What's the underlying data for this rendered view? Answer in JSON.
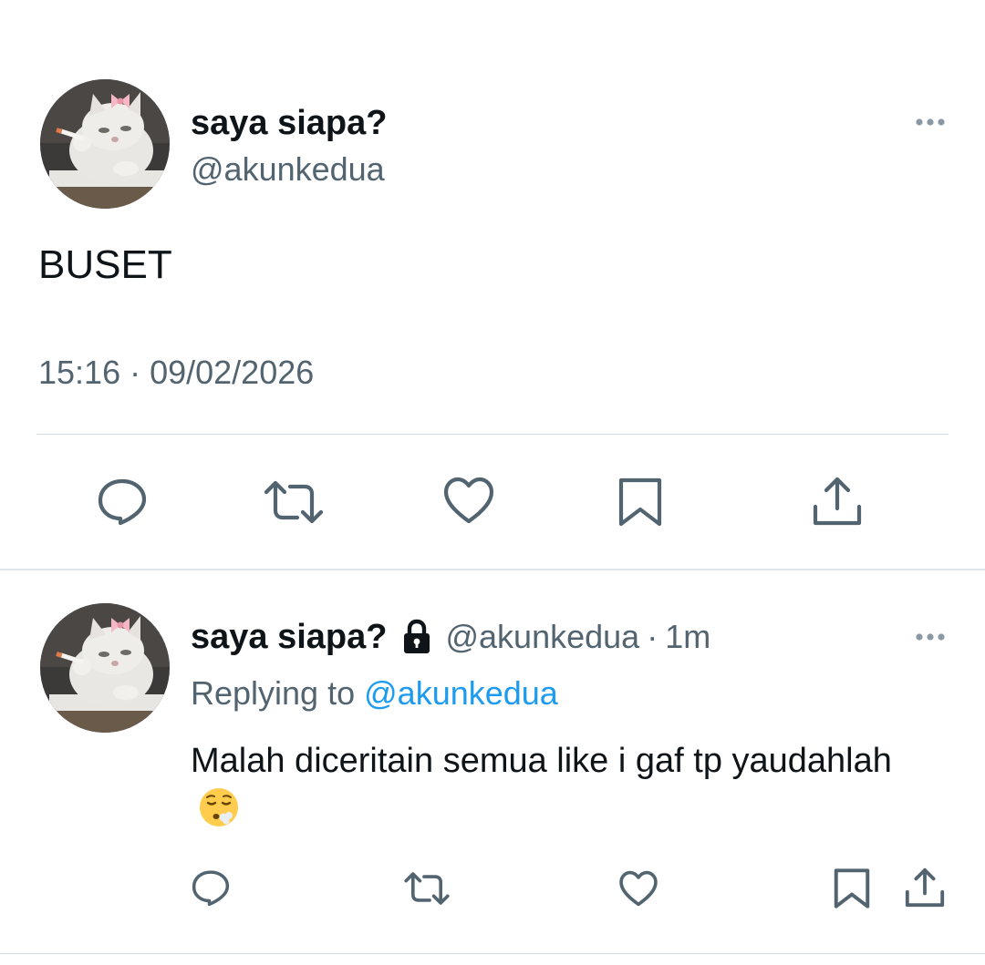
{
  "main_tweet": {
    "display_name": "saya siapa?",
    "handle": "@akunkedua",
    "text": "BUSET",
    "timestamp": "15:16 · 09/02/2026",
    "avatar_icon": "cat-avatar",
    "more_icon": "more-horizontal-icon",
    "actions": [
      "reply-icon",
      "retweet-icon",
      "like-icon",
      "bookmark-icon",
      "share-icon"
    ]
  },
  "reply": {
    "display_name": "saya siapa?",
    "protected_icon": "lock-icon",
    "handle": "@akunkedua",
    "separator": "·",
    "time_ago": "1m",
    "replying_to_label": "Replying to",
    "replying_to_handle": "@akunkedua",
    "text": "Malah diceritain semua like i gaf tp yaudahlah",
    "emoji": "face-exhaling-emoji",
    "actions": [
      "reply-icon",
      "retweet-icon",
      "like-icon",
      "bookmark-icon",
      "share-icon"
    ]
  },
  "colors": {
    "text_primary": "#0f1419",
    "text_secondary": "#536471",
    "link": "#1d9bf0",
    "divider": "#cfd9de"
  }
}
